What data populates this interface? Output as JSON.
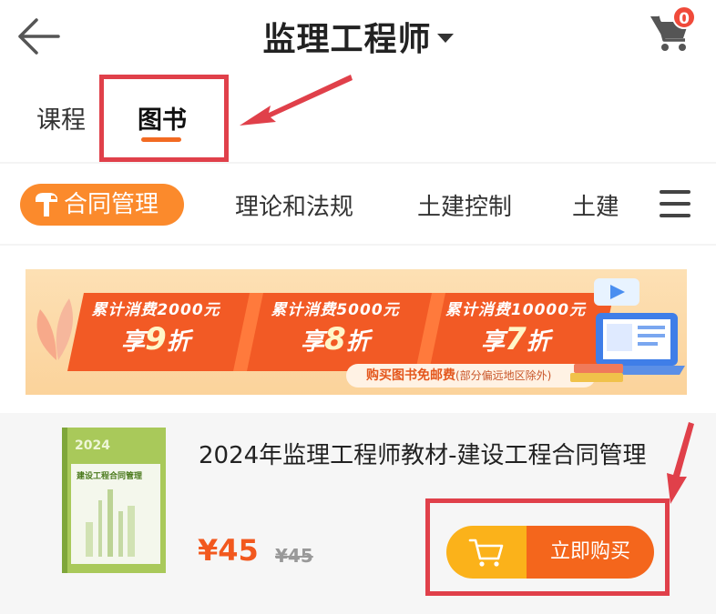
{
  "header": {
    "title": "监理工程师",
    "cart_count": "0"
  },
  "tabs": [
    {
      "label": "课程",
      "active": false
    },
    {
      "label": "图书",
      "active": true
    }
  ],
  "categories": {
    "active": "合同管理",
    "items": [
      "理论和法规",
      "土建控制",
      "土建"
    ]
  },
  "banner": {
    "promos": [
      {
        "line1": "累计消费2000元",
        "line2_pre": "享",
        "line2_num": "9",
        "line2_post": "折"
      },
      {
        "line1": "累计消费5000元",
        "line2_pre": "享",
        "line2_num": "8",
        "line2_post": "折"
      },
      {
        "line1": "累计消费10000元",
        "line2_pre": "享",
        "line2_num": "7",
        "line2_post": "折"
      }
    ],
    "shipping": "购买图书免邮费",
    "shipping_note": "(部分偏远地区除外)"
  },
  "product": {
    "title": "2024年监理工程师教材-建设工程合同管理",
    "price": "¥45",
    "original_price": "¥45",
    "buy_label": "立即购买",
    "cover": {
      "year": "2024",
      "subtitle": "建设工程合同管理"
    }
  },
  "colors": {
    "accent": "#f26a22",
    "pill": "#fb8a2c",
    "price": "#f2581e",
    "badge": "#f04a3a",
    "annotation": "#e0404a",
    "buy_left": "#fbb21a",
    "buy_right": "#f4661c"
  },
  "icons": {
    "back": "arrow-left-icon",
    "cart": "shopping-cart-icon",
    "category": "hammer-icon",
    "menu": "hamburger-menu-icon"
  }
}
